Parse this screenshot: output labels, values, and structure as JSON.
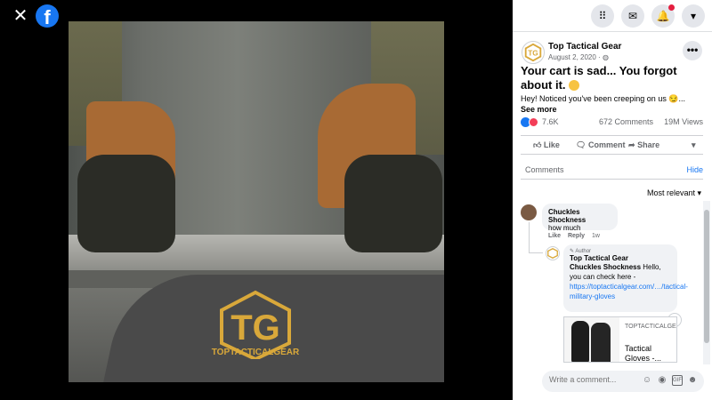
{
  "viewer": {
    "close_icon": "close-icon",
    "logo_icon": "facebook-logo-icon"
  },
  "topbar": {
    "icons": [
      "menu-grid-icon",
      "messenger-icon",
      "notifications-bell-icon",
      "account-caret-icon"
    ],
    "notification_dot_color": "#e41e3f"
  },
  "media": {
    "watermark_text": "TOPTACTICALGEAR",
    "watermark_color": "#d9a83a"
  },
  "post": {
    "page_name": "Top Tactical Gear",
    "date": "August 2, 2020 ·",
    "headline": "Your cart is sad... You forgot about it.",
    "body": "Hey! Noticed you've been creeping on us 😏...",
    "see_more": "See more",
    "reaction_count": "7.6K",
    "comment_count": "672 Comments",
    "view_count": "19M Views",
    "actions": {
      "like": "Like",
      "comment": "Comment",
      "share": "Share"
    }
  },
  "comments_section": {
    "label": "Comments",
    "hide": "Hide",
    "sort": "Most relevant ▾",
    "comment1": {
      "author": "Chuckles Shockness",
      "text": "how much",
      "like": "Like",
      "reply": "Reply",
      "time": "1w"
    },
    "reply1": {
      "badge": "Author",
      "page": "Top Tactical Gear",
      "mention": "Chuckles Shockness",
      "text": " Hello, you can check here - ",
      "link": "https://toptacticalgear.com/…/tactical-military-gloves"
    },
    "link_card": {
      "domain": "TOPTACTICALGEAR.COM",
      "title": "Tactical Gloves -..."
    }
  },
  "comment_box": {
    "placeholder": "Write a comment..."
  },
  "colors": {
    "brand": "#1877f2",
    "text": "#050505",
    "muted": "#65676b",
    "bubble": "#f0f2f5"
  }
}
